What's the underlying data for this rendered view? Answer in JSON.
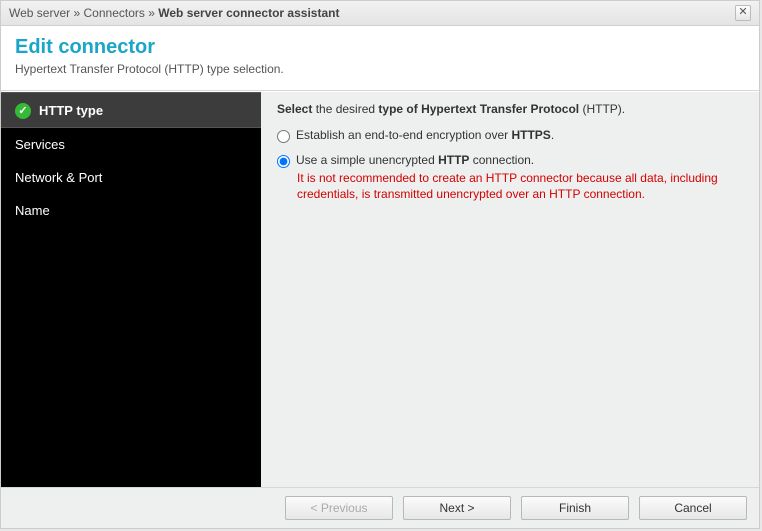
{
  "breadcrumb": {
    "part1": "Web server",
    "sep": "»",
    "part2": "Connectors",
    "part3": "Web server connector assistant"
  },
  "header": {
    "title": "Edit connector",
    "subtitle": "Hypertext Transfer Protocol (HTTP) type selection."
  },
  "sidebar": {
    "items": [
      {
        "label": "HTTP type",
        "active": true
      },
      {
        "label": "Services",
        "active": false
      },
      {
        "label": "Network & Port",
        "active": false
      },
      {
        "label": "Name",
        "active": false
      }
    ]
  },
  "content": {
    "instruction_prefix": "Select",
    "instruction_mid1": " the desired ",
    "instruction_bold2": "type of Hypertext Transfer Protocol",
    "instruction_suffix": " (HTTP).",
    "option_https_pre": "Establish an end-to-end encryption over ",
    "option_https_bold": "HTTPS",
    "option_https_post": ".",
    "option_http_pre": "Use a simple unencrypted ",
    "option_http_bold": "HTTP",
    "option_http_post": " connection.",
    "warning": "It is not recommended to create an HTTP connector because all data, including credentials, is transmitted unencrypted over an HTTP connection.",
    "selected": "http"
  },
  "footer": {
    "previous": "< Previous",
    "next": "Next >",
    "finish": "Finish",
    "cancel": "Cancel"
  }
}
